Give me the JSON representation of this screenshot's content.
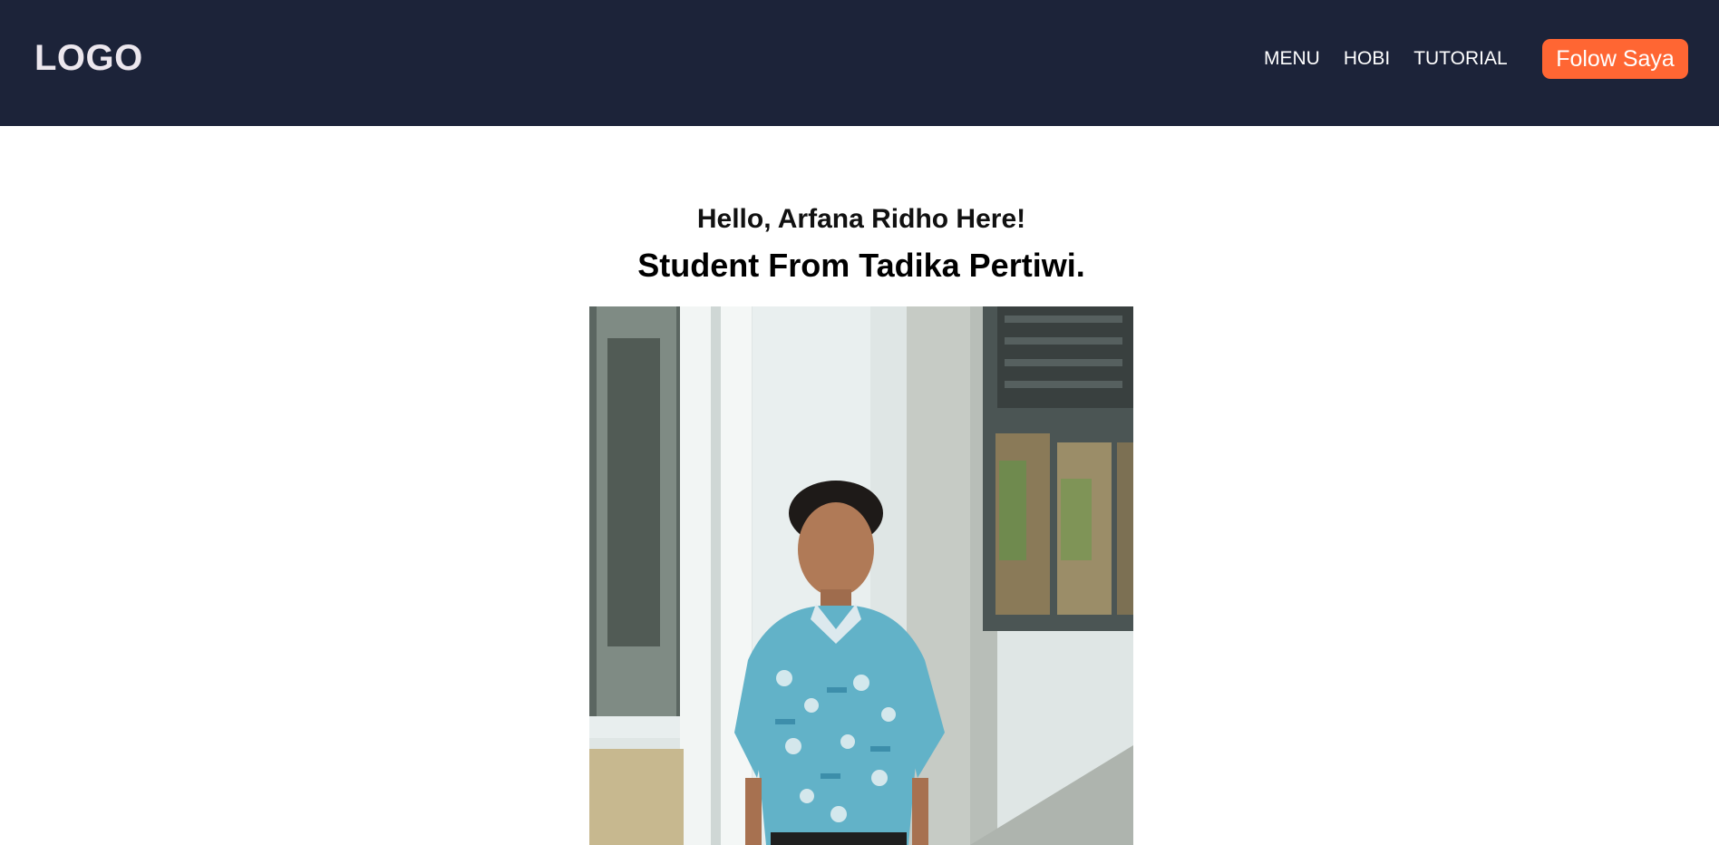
{
  "header": {
    "logo": "LOGO",
    "nav": [
      {
        "label": "MENU"
      },
      {
        "label": "HOBI"
      },
      {
        "label": "TUTORIAL"
      }
    ],
    "follow_label": "Folow Saya"
  },
  "hero": {
    "greeting": "Hello, Arfana Ridho Here!",
    "subtitle": "Student From Tadika Pertiwi."
  },
  "colors": {
    "navbar_bg": "#1c2339",
    "accent": "#ff6633",
    "text_light": "#ffffff"
  }
}
